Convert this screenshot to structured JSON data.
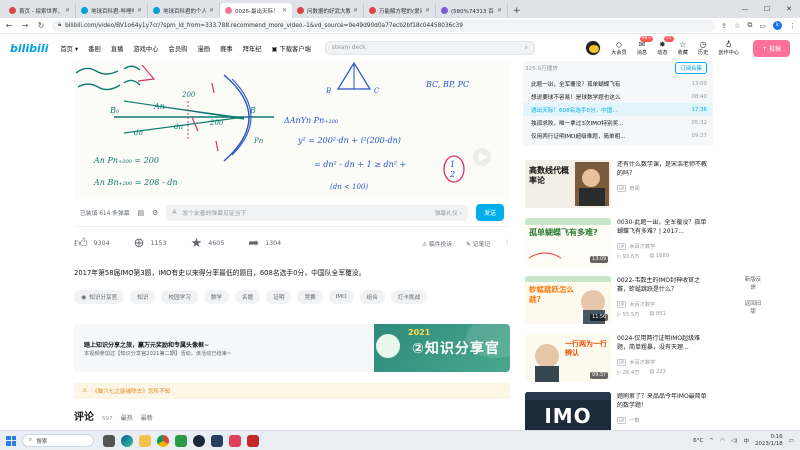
{
  "browser": {
    "tabs": [
      {
        "title": "首页 - 探索世界，共同创",
        "color": "#d44"
      },
      {
        "title": "地球百科君-哔哩哔哩_Bili",
        "color": "#00a1d6"
      },
      {
        "title": "地球百科君的个人空间_哔",
        "color": "#00a1d6"
      },
      {
        "title": "0026-最出天际！608名选手",
        "color": "#fb7299",
        "active": true
      },
      {
        "title": "问数据的好武大教 - 百度",
        "color": "#d44"
      },
      {
        "title": "万能解方程的(爱问数学",
        "color": "#d44"
      },
      {
        "title": "(580%74313 百度搜索",
        "color": "#7b5cd6"
      }
    ],
    "new_tab": "+",
    "url": "bilibili.com/video/BV1o64y1y7cr/?spm_id_from=333.788.recommend_more_video.-1&vd_source=9e49d90d0a77ecb2bf18c04458036c39",
    "profile_initial": "k"
  },
  "header": {
    "logo": "bilibili",
    "nav": [
      "首页 ▾",
      "番剧",
      "直播",
      "游戏中心",
      "会员购",
      "漫画",
      "赛事",
      "拜年纪",
      "下载客户端"
    ],
    "search_placeholder": "steam deck",
    "icons": [
      {
        "label": "大会员",
        "glyph": "◇"
      },
      {
        "label": "消息",
        "glyph": "✉",
        "badge": "99+"
      },
      {
        "label": "动态",
        "glyph": "✸",
        "badge": "31"
      },
      {
        "label": "收藏",
        "glyph": "☆"
      },
      {
        "label": "历史",
        "glyph": "◷"
      },
      {
        "label": "创作中心",
        "glyph": "♁"
      }
    ],
    "post_label": "↑ 投稿"
  },
  "danmu": {
    "viewers": "已装填 614 条弹幕",
    "placeholder": "发个友善的弹幕见证当下",
    "etiquette": "弹幕礼仪 ›",
    "send": "发送"
  },
  "actions": {
    "like": "9304",
    "coin": "1153",
    "fav": "4605",
    "share": "1304",
    "report": "稿件投诉",
    "note": "记笔记"
  },
  "description": "2017年第58届IMO第3题，IMO有史以来得分率最低的题目，608名选手0分，中国队全军覆没。",
  "tags": [
    "知识分享官",
    "知识",
    "校园学习",
    "数学",
    "名题",
    "证明",
    "竞赛",
    "IMO",
    "组合",
    "打卡挑战"
  ],
  "banner": {
    "title": "踏上知识分享之旅，赢万元奖励和专属头像框~",
    "subtitle": "本视频参加过【知识分享官2021第二期】活动，该活动已结束~",
    "year": "2021",
    "big": "②知识分享官"
  },
  "notice": "《脑六七之能被除去》您所不知",
  "comments": {
    "heading": "评论",
    "count": "597",
    "sort_hot": "最热",
    "sort_new": "最新"
  },
  "playlist": {
    "header": "325.9万播放",
    "button": "订阅合集",
    "items": [
      {
        "title": "此题一出，全军覆没？孤单蝴蝶飞有",
        "dur": "13:09"
      },
      {
        "title": "想说要球不容易！是球数学题也这么",
        "dur": "08:40"
      },
      {
        "title": "遇出天际！608名选手0分，中国...",
        "dur": "17:36",
        "active": true
      },
      {
        "title": "独孤求败，唯一拿过3次IMO特别奖...",
        "dur": "05:32"
      },
      {
        "title": "仅用两行证明IMO超级难题，简单粗...",
        "dur": "09:37"
      }
    ]
  },
  "recs": [
    {
      "title": "还有什么数学课，是宋浩老师不教的吗？",
      "up": "奇闻",
      "views": "",
      "dmk": "",
      "dur": "",
      "thumb_text": "高数线代概率论"
    },
    {
      "title": "0030-此题一出，全军覆没？孤单蝴蝶飞有多难？| 2017...",
      "up": "木百才数学",
      "views": "93.6万",
      "dmk": "1680",
      "dur": "13:09",
      "thumb_text": "孤单蝴蝶飞有多难?"
    },
    {
      "title": "0022-韦数主的IMO封神收官之赛，蚱蜢跳跃是什么？",
      "up": "木百才数学",
      "views": "55.5万",
      "dmk": "851",
      "dur": "11:56",
      "thumb_text": "蚱蜢跳跃怎么跳?"
    },
    {
      "title": "0024-仅用两行证明IMO超级难题，简单粗暴，没有天理...",
      "up": "木百才数学",
      "views": "26.4万",
      "dmk": "223",
      "dur": "09:37",
      "thumb_text": "一行两为一行辨认"
    },
    {
      "title": "题刷累了？来品品今年IMO最简单的数学题！",
      "up": "一数",
      "views": "",
      "dmk": "",
      "dur": "",
      "thumb_text": "IMO"
    }
  ],
  "right_tools": [
    "新版反馈",
    "返回旧版"
  ],
  "taskbar": {
    "search": "搜索",
    "temp": "6°C",
    "time": "0:16",
    "date": "2023/1/18",
    "lang": "中"
  }
}
